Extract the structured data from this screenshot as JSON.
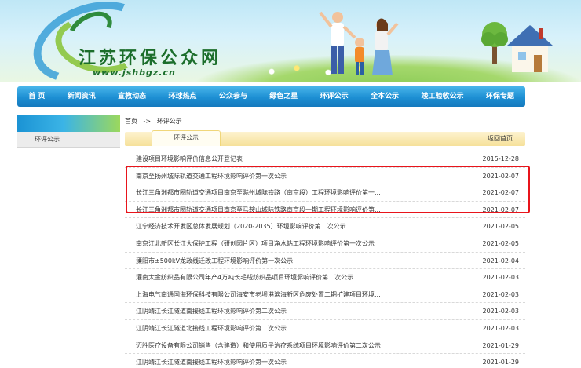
{
  "header": {
    "site_title": "江苏环保公众网",
    "site_url": "www.jshbgz.cn"
  },
  "nav": {
    "items": [
      "首 页",
      "新闻资讯",
      "宣教动态",
      "环球热点",
      "公众参与",
      "绿色之星",
      "环评公示",
      "全本公示",
      "竣工验收公示",
      "环保专题"
    ]
  },
  "sidebar": {
    "items": [
      "环评公示"
    ]
  },
  "breadcrumb": {
    "home": "首页",
    "separator": "->",
    "current": "环评公示"
  },
  "section": {
    "title": "环评公示",
    "back_label": "返回首页"
  },
  "list": [
    {
      "title": "建设项目环境影响评价信息公开登记表",
      "date": "2015-12-28"
    },
    {
      "title": "南京至扬州城际轨道交通工程环境影响评价第一次公示",
      "date": "2021-02-07"
    },
    {
      "title": "长江三角洲都市圈轨道交通项目南京至滁州城际铁路（南京段）工程环境影响评价第一...",
      "date": "2021-02-07"
    },
    {
      "title": "长江三角洲都市圈轨道交通项目南京至马鞍山城际铁路南京段一期工程环境影响评价第...",
      "date": "2021-02-07"
    },
    {
      "title": "江宁经济技术开发区总体发展规划（2020-2035）环境影响评价第二次公示",
      "date": "2021-02-05"
    },
    {
      "title": "南京江北新区长江大保护工程（研创园片区）项目净水站工程环境影响评价第一次公示",
      "date": "2021-02-05"
    },
    {
      "title": "溧阳市±500kV龙政线迁改工程环境影响评价第一次公示",
      "date": "2021-02-04"
    },
    {
      "title": "灌南太金纺织品有限公司年产4万吨长毛绒纺织品项目环境影响评价第二次公示",
      "date": "2021-02-03"
    },
    {
      "title": "上海电气南通国海环保科技有限公司海安市老坝港滨海新区危废处置二期扩建项目环境...",
      "date": "2021-02-03"
    },
    {
      "title": "江阴靖江长江隧道南接线工程环境影响评价第二次公示",
      "date": "2021-02-03"
    },
    {
      "title": "江阴靖江长江隧道北接线工程环境影响评价第二次公示",
      "date": "2021-02-03"
    },
    {
      "title": "迈胜医疗设备有限公司销售（含建造）和使用质子治疗系统项目环境影响评价第二次公示",
      "date": "2021-01-29"
    },
    {
      "title": "江阴靖江长江隧道南接线工程环境影响评价第一次公示",
      "date": "2021-01-29"
    }
  ],
  "colors": {
    "nav_blue": "#1d8fd3",
    "highlight_red": "#e8141b",
    "brand_green": "#1c6e2b",
    "section_yellow": "#f6e19a"
  }
}
